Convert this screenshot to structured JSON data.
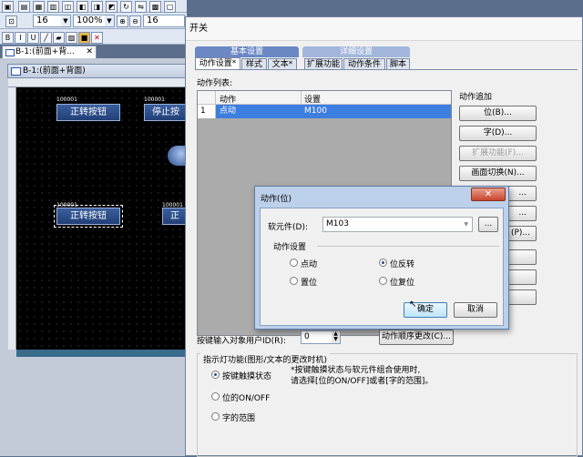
{
  "toolbar": {
    "font_size": "16",
    "zoom": "100%",
    "font_size2": "16"
  },
  "canvas_window": {
    "tab_label": "B-1:(前面+背...",
    "title": "B-1:(前面+背面)",
    "buttons": [
      {
        "label": "正转按钮",
        "tag": "100001"
      },
      {
        "label": "停止按",
        "tag": "100001"
      },
      {
        "label": "正转按钮",
        "tag": "100001"
      },
      {
        "label": "正",
        "tag": "100001"
      }
    ]
  },
  "switch_dialog": {
    "title": "开关",
    "group_basic": "基本设置",
    "group_detail": "详细设置",
    "tabs": [
      "动作设置*",
      "样式",
      "文本*",
      "扩展功能",
      "动作条件",
      "脚本"
    ],
    "action_list_label": "动作列表:",
    "table_headers": [
      "动作",
      "设置"
    ],
    "rows": [
      {
        "no": "1",
        "action": "点动",
        "setting": "M100"
      }
    ],
    "action_add_label": "动作追加",
    "add_buttons": [
      "位(B)...",
      "字(D)...",
      "扩展功能(F)...",
      "画面切换(N)...",
      "...",
      "...",
      "(P)...",
      "",
      "",
      ""
    ],
    "user_id_label": "按键输入对象用户ID(R):",
    "user_id_value": "0",
    "order_button": "动作顺序更改(C)...",
    "indicator_group": "指示灯功能(图形/文本的更改时机)",
    "indicator_options": [
      "按键触摸状态",
      "位的ON/OFF",
      "字的范围"
    ],
    "indicator_note": "*按键触摸状态与软元件组合使用时,\n请选择[位的ON/OFF]或者[字的范围]。"
  },
  "bit_dialog": {
    "title": "动作(位)",
    "device_label": "软元件(D):",
    "device_value": "M103",
    "browse_label": "...",
    "section_label": "动作设置",
    "options": [
      "点动",
      "位反转",
      "置位",
      "位复位"
    ],
    "ok": "确定",
    "cancel": "取消"
  }
}
